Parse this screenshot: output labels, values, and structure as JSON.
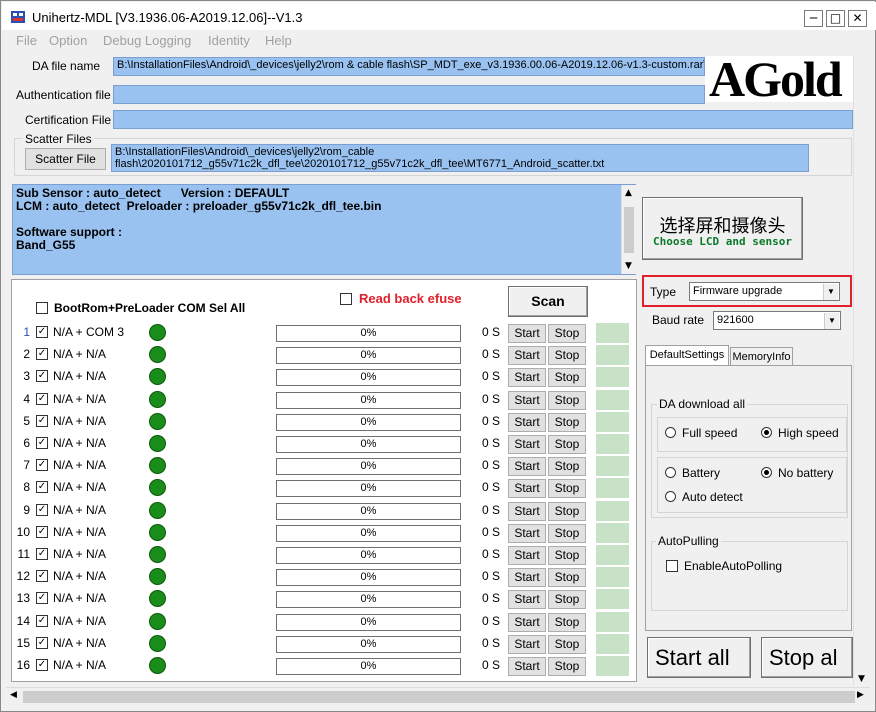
{
  "window": {
    "title": "Unihertz-MDL [V3.1936.06-A2019.12.06]--V1.3",
    "minimize": "─",
    "maximize": "□",
    "close": "✕"
  },
  "menu": [
    "File",
    "Option",
    "Debug Logging",
    "Identity",
    "Help"
  ],
  "files": {
    "da_label": "DA file name",
    "da_value": "B:\\InstallationFiles\\Android\\_devices\\jelly2\\rom & cable flash\\SP_MDT_exe_v3.1936.00.06-A2019.12.06-v1.3-custom.rar\\S",
    "auth_label": "Authentication file",
    "auth_value": "",
    "cert_label": "Certification File",
    "cert_value": "",
    "scatter_group": "Scatter Files",
    "scatter_button": "Scatter File",
    "scatter_line1": "B:\\InstallationFiles\\Android\\_devices\\jelly2\\rom_cable",
    "scatter_line2": "flash\\2020101712_g55v71c2k_dfl_tee\\2020101712_g55v71c2k_dfl_tee\\MT6771_Android_scatter.txt"
  },
  "logo": "AGold",
  "info": {
    "line1": "Sub Sensor : auto_detect      Version : DEFAULT",
    "line2": "LCM : auto_detect  Preloader : preloader_g55v71c2k_dfl_tee.bin",
    "line3": "",
    "line4": "Software support :",
    "line5": "Band_G55"
  },
  "lcd_button": {
    "cn": "选择屏和摄像头",
    "en": "Choose LCD and sensor"
  },
  "ports": {
    "sel_all_label": "BootRom+PreLoader COM Sel All",
    "read_back_label": "Read back efuse",
    "scan_label": "Scan",
    "start_label": "Start",
    "stop_label": "Stop",
    "rows": [
      {
        "num": "1",
        "port": "N/A + COM 3",
        "progress": "0%",
        "time": "0 S"
      },
      {
        "num": "2",
        "port": "N/A + N/A",
        "progress": "0%",
        "time": "0 S"
      },
      {
        "num": "3",
        "port": "N/A + N/A",
        "progress": "0%",
        "time": "0 S"
      },
      {
        "num": "4",
        "port": "N/A + N/A",
        "progress": "0%",
        "time": "0 S"
      },
      {
        "num": "5",
        "port": "N/A + N/A",
        "progress": "0%",
        "time": "0 S"
      },
      {
        "num": "6",
        "port": "N/A + N/A",
        "progress": "0%",
        "time": "0 S"
      },
      {
        "num": "7",
        "port": "N/A + N/A",
        "progress": "0%",
        "time": "0 S"
      },
      {
        "num": "8",
        "port": "N/A + N/A",
        "progress": "0%",
        "time": "0 S"
      },
      {
        "num": "9",
        "port": "N/A + N/A",
        "progress": "0%",
        "time": "0 S"
      },
      {
        "num": "10",
        "port": "N/A + N/A",
        "progress": "0%",
        "time": "0 S"
      },
      {
        "num": "11",
        "port": "N/A + N/A",
        "progress": "0%",
        "time": "0 S"
      },
      {
        "num": "12",
        "port": "N/A + N/A",
        "progress": "0%",
        "time": "0 S"
      },
      {
        "num": "13",
        "port": "N/A + N/A",
        "progress": "0%",
        "time": "0 S"
      },
      {
        "num": "14",
        "port": "N/A + N/A",
        "progress": "0%",
        "time": "0 S"
      },
      {
        "num": "15",
        "port": "N/A + N/A",
        "progress": "0%",
        "time": "0 S"
      },
      {
        "num": "16",
        "port": "N/A + N/A",
        "progress": "0%",
        "time": "0 S"
      }
    ]
  },
  "settings": {
    "type_label": "Type",
    "type_value": "Firmware upgrade",
    "baud_label": "Baud rate",
    "baud_value": "921600",
    "tab1": "DefaultSettings",
    "tab2": "MemoryInfo",
    "da_group": "DA download all",
    "full_speed": "Full speed",
    "high_speed": "High speed",
    "battery": "Battery",
    "no_battery": "No battery",
    "auto_detect": "Auto detect",
    "autopolling_group": "AutoPulling",
    "enable_autopolling": "EnableAutoPolling",
    "start_all": "Start all",
    "stop_all": "Stop al"
  },
  "colors": {
    "field_bg": "#99c2f1",
    "highlight_border": "#e0202a",
    "led_green": "#1a8c1a",
    "read_back_red": "#e0202a"
  }
}
